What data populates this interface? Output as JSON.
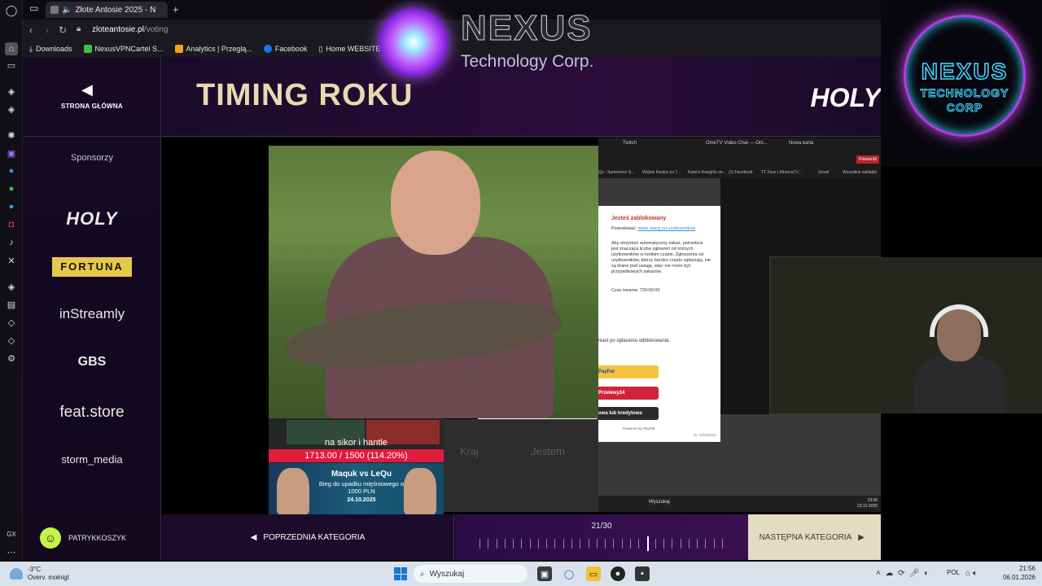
{
  "browser": {
    "tab_title": "Złote Antosie 2025 - N",
    "url_domain": "zloteantosie.pl",
    "url_path": "/voting",
    "bookmarks": [
      "Downloads",
      "NexusVPNCartel S...",
      "Analytics | Przeglą...",
      "Facebook",
      "Home WEBSITE"
    ],
    "sidebar_bottom_label": "GX"
  },
  "page": {
    "home_label": "STRONA GŁÓWNA",
    "title": "TIMING ROKU",
    "sponsors_title": "Sponsorzy",
    "sponsors": [
      "HOLY",
      "FORTUNA",
      "inStreamly",
      "GBS",
      "feat.store",
      "storm_media"
    ],
    "header_brand": "HOLY",
    "username": "PATRYKKOSZYK",
    "prev_label": "POPRZEDNIA KATEGORIA",
    "next_label": "NASTĘPNA KATEGORIA",
    "progress_text": "21/30",
    "progress_current": 21,
    "progress_total": 30
  },
  "clip": {
    "goal_title": "na sikor i hantle",
    "goal_text": "1713.00 / 1500 (114.20%)",
    "promo_line1": "Maquk vs LeQu",
    "promo_line2": "Bieg do upadku mięśniowego o 1000 PLN",
    "promo_line3": "24.10.2025",
    "word_kraj": "Kraj",
    "word_jestem": "Jestem",
    "ss_tabs": [
      "Twitch",
      "OmeTV Video Chat — Onl...",
      "Nowa karta"
    ],
    "ss_bookmarks": [
      "Qu - Summoner S...",
      "Wojtek Kardys na T...",
      "Kubo's thoughts on...",
      "(1) Facebook",
      "TT Zeus | AfreecaTV...",
      "Gmail",
      "Wszystkie zakładki"
    ],
    "ss_search": "Wyszukaj",
    "ss_time": "19:36",
    "ss_date": "23.10.2025",
    "ss_btn": "Potwierdź"
  },
  "modal": {
    "title": "Jesteś zablokowany",
    "reason_label": "Powodować:",
    "reason_link": "wiele skarg od użytkowników",
    "description": "Aby otrzymać automatyczny zakaz, potrzebna jest znacząca liczba zgłoszeń od różnych użytkowników w krótkim czasie. Zgłoszenia od użytkowników, którzy bardzo często zgłaszają, nie są brane pod uwagę, więc nie może być przypadkowych zakazów.",
    "duration": "Czas trwania: 720:00:09",
    "unlock_text": "miast po opłaceniu odblokowania.",
    "pay_paypal": "PayPal",
    "pay_p24": "Przelewy24",
    "pay_card": "owa lub kredytowa",
    "powered": "Powered by PayPal",
    "contact": "contact@ome.tv",
    "id": "ID: 326d0918"
  },
  "overlay": {
    "brand_name": "NEXUS",
    "brand_sub": "Technology Corp.",
    "badge_line1": "NEXUS",
    "badge_line2": "TECHNOLOGY",
    "badge_line3": "CORP"
  },
  "taskbar": {
    "temp": "-3°C",
    "weather": "Overv. mołnigt",
    "search": "Wyszukaj",
    "lang": "POL",
    "time": "21:56",
    "date": "06.01.2026"
  },
  "colors": {
    "accent_purple": "#3a1050",
    "title_gold": "#e9d9b0",
    "goal_red": "#e01b3c",
    "next_bg": "#e4dcc2"
  }
}
